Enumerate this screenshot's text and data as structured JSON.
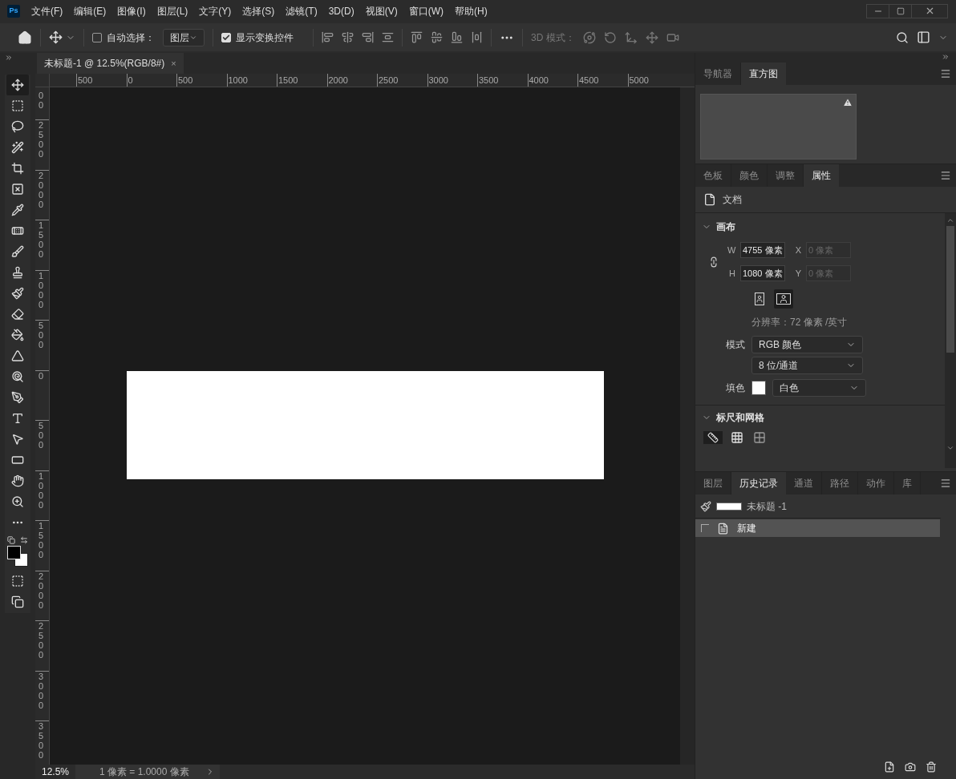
{
  "app_logo": "Ps",
  "menu": [
    "文件(F)",
    "编辑(E)",
    "图像(I)",
    "图层(L)",
    "文字(Y)",
    "选择(S)",
    "滤镜(T)",
    "3D(D)",
    "视图(V)",
    "窗口(W)",
    "帮助(H)"
  ],
  "options_bar": {
    "auto_select": {
      "label": "自动选择：",
      "checked": false
    },
    "target": "图层",
    "show_transform": {
      "label": "显示变换控件",
      "checked": true
    },
    "mode_3d": {
      "label": "3D 模式：",
      "disabled": true
    }
  },
  "document_tab": {
    "title": "未标题-1 @ 12.5%(RGB/8#)",
    "close": "×"
  },
  "rulers": {
    "horizontal": [
      "500",
      "0",
      "500",
      "1000",
      "1500",
      "2000",
      "2500",
      "3000",
      "3500",
      "4000",
      "4500",
      "5000"
    ],
    "vertical": [
      "00",
      "2500",
      "2000",
      "1500",
      "1000",
      "500",
      "0",
      "500",
      "1000",
      "1500",
      "2000",
      "2500",
      "3000",
      "3500"
    ]
  },
  "tools": [
    {
      "kind": "move",
      "selected": true
    },
    {
      "kind": "marquee",
      "selected": false
    },
    {
      "kind": "lasso",
      "selected": false
    },
    {
      "kind": "quick-select",
      "selected": false
    },
    {
      "kind": "crop",
      "selected": false
    },
    {
      "kind": "frame",
      "selected": false
    },
    {
      "kind": "eyedropper",
      "selected": false
    },
    {
      "kind": "healing",
      "selected": false
    },
    {
      "kind": "brush",
      "selected": false
    },
    {
      "kind": "stamp",
      "selected": false
    },
    {
      "kind": "history-brush",
      "selected": false
    },
    {
      "kind": "eraser",
      "selected": false
    },
    {
      "kind": "bucket",
      "selected": false
    },
    {
      "kind": "blur",
      "selected": false
    },
    {
      "kind": "dodge",
      "selected": false
    },
    {
      "kind": "pen",
      "selected": false
    },
    {
      "kind": "type",
      "selected": false
    },
    {
      "kind": "path-select",
      "selected": false
    },
    {
      "kind": "shape",
      "selected": false
    },
    {
      "kind": "hand",
      "selected": false
    },
    {
      "kind": "zoom",
      "selected": false
    },
    {
      "kind": "more",
      "selected": false
    }
  ],
  "top_panel": {
    "tabs": [
      {
        "label": "导航器",
        "selected": false
      },
      {
        "label": "直方图",
        "selected": true
      }
    ]
  },
  "properties_panel": {
    "tabs": [
      {
        "label": "色板",
        "selected": false
      },
      {
        "label": "颜色",
        "selected": false
      },
      {
        "label": "调整",
        "selected": false
      },
      {
        "label": "属性",
        "selected": true
      }
    ],
    "document_label": "文档",
    "canvas": {
      "title": "画布",
      "expanded": true,
      "width": {
        "label": "W",
        "value": "4755 像素",
        "disabled": false
      },
      "x": {
        "label": "X",
        "value": "0 像素",
        "disabled": true
      },
      "height": {
        "label": "H",
        "value": "1080 像素",
        "disabled": false
      },
      "y": {
        "label": "Y",
        "value": "0 像素",
        "disabled": true
      },
      "orientations": [
        {
          "kind": "portrait",
          "selected": false
        },
        {
          "kind": "landscape",
          "selected": true
        }
      ],
      "resolution": "分辨率：72 像素 /英寸",
      "mode_label": "模式",
      "mode": "RGB 颜色",
      "depth": "8 位/通道",
      "fill_label": "填色",
      "fill": "白色"
    },
    "rulers_grids": {
      "title": "标尺和网格",
      "expanded": true
    }
  },
  "history_panel": {
    "tabs": [
      {
        "label": "图层",
        "selected": false
      },
      {
        "label": "历史记录",
        "selected": true
      },
      {
        "label": "通道",
        "selected": false
      },
      {
        "label": "路径",
        "selected": false
      },
      {
        "label": "动作",
        "selected": false
      },
      {
        "label": "库",
        "selected": false
      }
    ],
    "snapshot": {
      "label": "未标题 -1"
    },
    "states": [
      {
        "label": "新建",
        "selected": true
      }
    ]
  },
  "status_bar": {
    "zoom": "12.5%",
    "info": "1 像素 = 1.0000 像素"
  }
}
